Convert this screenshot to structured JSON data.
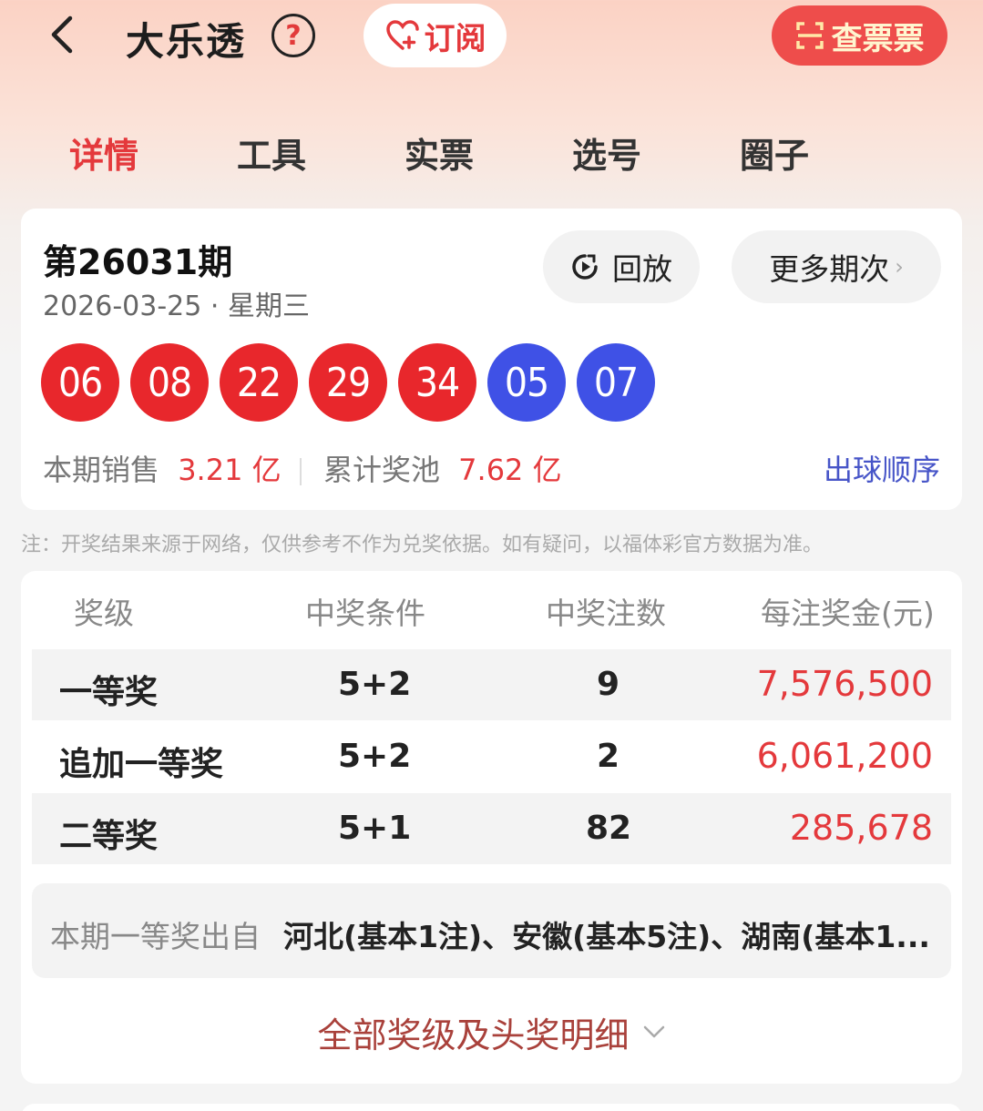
{
  "header": {
    "title": "大乐透",
    "help_icon": "?",
    "subscribe_label": "订阅",
    "check_label": "查票票"
  },
  "tabs": [
    {
      "label": "详情",
      "active": true
    },
    {
      "label": "工具",
      "active": false
    },
    {
      "label": "实票",
      "active": false
    },
    {
      "label": "选号",
      "active": false
    },
    {
      "label": "圈子",
      "active": false
    }
  ],
  "draw": {
    "issue": "第26031期",
    "date": "2026-03-25 · 星期三",
    "replay_label": "回放",
    "more_label": "更多期次",
    "red_balls": [
      "06",
      "08",
      "22",
      "29",
      "34"
    ],
    "blue_balls": [
      "05",
      "07"
    ],
    "sales_label": "本期销售",
    "sales_value": "3.21 亿",
    "pool_label": "累计奖池",
    "pool_value": "7.62 亿",
    "order_label": "出球顺序"
  },
  "note": "注：开奖结果来源于网络，仅供参考不作为兑奖依据。如有疑问，以福体彩官方数据为准。",
  "prize_table": {
    "headers": [
      "奖级",
      "中奖条件",
      "中奖注数",
      "每注奖金(元)"
    ],
    "rows": [
      {
        "level": "一等奖",
        "condition": "5+2",
        "count": "9",
        "amount": "7,576,500"
      },
      {
        "level": "追加一等奖",
        "condition": "5+2",
        "count": "2",
        "amount": "6,061,200"
      },
      {
        "level": "二等奖",
        "condition": "5+1",
        "count": "82",
        "amount": "285,678"
      }
    ],
    "origin_label": "本期一等奖出自",
    "origin_value": "河北(基本1注)、安徽(基本5注)、湖南(基本1...",
    "all_label": "全部奖级及头奖明细"
  },
  "colors": {
    "accent_red": "#e4393c",
    "red_ball": "#e8272c",
    "blue_ball": "#3f51e6",
    "link_blue": "#4755c8"
  }
}
